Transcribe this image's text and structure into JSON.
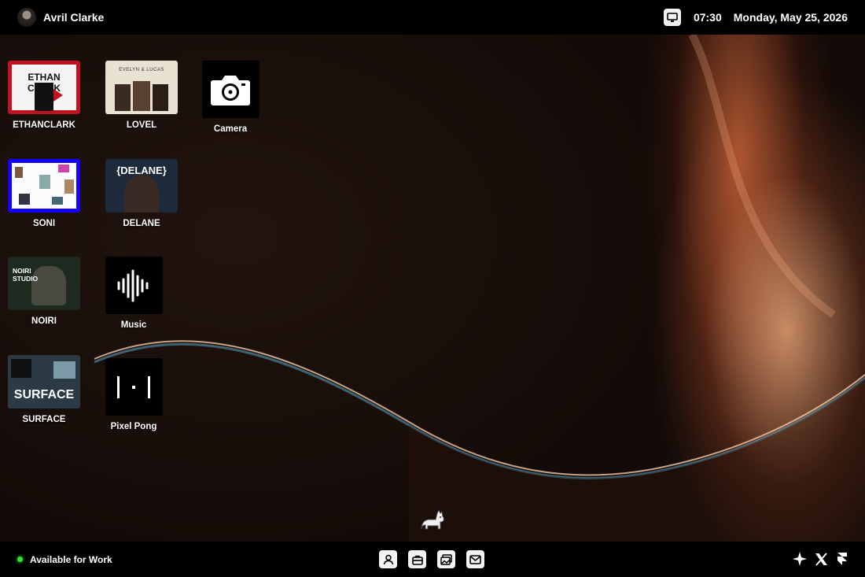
{
  "topbar": {
    "username": "Avril Clarke",
    "time": "07:30",
    "date": "Monday, May 25, 2026",
    "monitor_icon": "monitor-icon"
  },
  "desktop": {
    "icons": [
      {
        "label": "ETHANCLARK",
        "kind": "website-thumbnail",
        "thumb_text": "ETHAN CLARK",
        "accent": "#c1121f"
      },
      {
        "label": "LOVEL",
        "kind": "website-thumbnail",
        "thumb_text": "EVELYN & LUCAS",
        "accent": "#e9e2d3"
      },
      {
        "label": "Camera",
        "kind": "app",
        "icon": "camera-icon"
      },
      {
        "label": "SONI",
        "kind": "website-thumbnail",
        "accent": "#1400ff"
      },
      {
        "label": "DELANE",
        "kind": "website-thumbnail",
        "thumb_text": "{DELANE}",
        "accent": "#1c2a3c"
      },
      {
        "label": "NOIRI",
        "kind": "website-thumbnail",
        "thumb_text": "NOIRI STUDIO",
        "accent": "#1e2a20"
      },
      {
        "label": "Music",
        "kind": "app",
        "icon": "sound-wave-icon"
      },
      {
        "label": "SURFACE",
        "kind": "website-thumbnail",
        "thumb_text": "SURFACE",
        "accent": "#2b3a45"
      },
      {
        "label": "Pixel Pong",
        "kind": "app",
        "icon": "pong-icon"
      }
    ]
  },
  "dock": {
    "status_text": "Available for Work",
    "status_color": "#35e02e",
    "center_buttons": [
      "user-icon",
      "briefcase-icon",
      "gallery-icon",
      "mail-icon"
    ],
    "right_icons": [
      "sparkle-icon",
      "x-logo-icon",
      "framer-icon"
    ]
  },
  "theme": {
    "bar": "#000000",
    "wave_highlight": "#f0a070"
  }
}
